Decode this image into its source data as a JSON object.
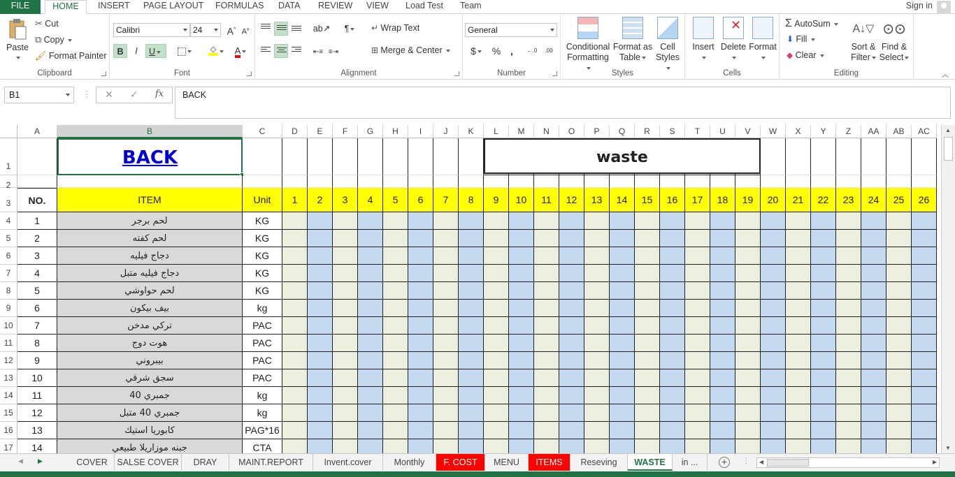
{
  "ribbon_tabs": [
    "FILE",
    "HOME",
    "INSERT",
    "PAGE LAYOUT",
    "FORMULAS",
    "DATA",
    "REVIEW",
    "VIEW",
    "Load Test",
    "Team"
  ],
  "sign_in": "Sign in",
  "clipboard": {
    "paste": "Paste",
    "cut": "Cut",
    "copy": "Copy",
    "format_painter": "Format Painter",
    "label": "Clipboard"
  },
  "font": {
    "name": "Calibri",
    "size": "24",
    "bold": "B",
    "italic": "I",
    "underline": "U",
    "color_glyph": "A",
    "label": "Font"
  },
  "alignment": {
    "wrap_text": "Wrap Text",
    "merge_center": "Merge & Center",
    "label": "Alignment"
  },
  "number": {
    "format": "General",
    "currency": "$",
    "percent": "%",
    "comma": ",",
    "inc": "←.0",
    "dec": ".00",
    "label": "Number"
  },
  "styles": {
    "conditional": "Conditional",
    "conditional2": "Formatting",
    "format_as": "Format as",
    "format_as2": "Table",
    "cell": "Cell",
    "cell2": "Styles",
    "label": "Styles"
  },
  "cells": {
    "insert": "Insert",
    "delete": "Delete",
    "format": "Format",
    "label": "Cells"
  },
  "editing": {
    "autosum": "AutoSum",
    "fill": "Fill",
    "clear": "Clear",
    "sort": "Sort &",
    "sort2": "Filter",
    "find": "Find &",
    "find2": "Select",
    "label": "Editing"
  },
  "formula_bar": {
    "name_box": "B1",
    "content": "BACK",
    "fx": "fx"
  },
  "columns": [
    "A",
    "B",
    "C",
    "D",
    "E",
    "F",
    "G",
    "H",
    "I",
    "J",
    "K",
    "L",
    "M",
    "N",
    "O",
    "P",
    "Q",
    "R",
    "S",
    "T",
    "U",
    "V",
    "W",
    "X",
    "Y",
    "Z",
    "AA",
    "AB",
    "AC"
  ],
  "rows": [
    "1",
    "2",
    "3",
    "4",
    "5",
    "6",
    "7",
    "8",
    "9",
    "10",
    "11",
    "12",
    "13",
    "14",
    "15",
    "16",
    "17"
  ],
  "sheet": {
    "back_link": "BACK",
    "title": "waste",
    "header": {
      "no": "NO.",
      "item": "ITEM",
      "unit": "Unit"
    },
    "days": [
      "1",
      "2",
      "3",
      "4",
      "5",
      "6",
      "7",
      "8",
      "9",
      "10",
      "11",
      "12",
      "13",
      "14",
      "15",
      "16",
      "17",
      "18",
      "19",
      "20",
      "21",
      "22",
      "23",
      "24",
      "25",
      "26"
    ],
    "items": [
      {
        "no": "1",
        "item": "لحم برجر",
        "unit": "KG"
      },
      {
        "no": "2",
        "item": "لحم كفته",
        "unit": "KG"
      },
      {
        "no": "3",
        "item": "دجاج فيليه",
        "unit": "KG"
      },
      {
        "no": "4",
        "item": "دجاج فيليه متبل",
        "unit": "KG"
      },
      {
        "no": "5",
        "item": "لحم حواوشي",
        "unit": "KG"
      },
      {
        "no": "6",
        "item": "بيف بيكون",
        "unit": "kg"
      },
      {
        "no": "7",
        "item": "تركي مدخن",
        "unit": "PAC"
      },
      {
        "no": "8",
        "item": "هوت دوج",
        "unit": "PAC"
      },
      {
        "no": "9",
        "item": "بيبروني",
        "unit": "PAC"
      },
      {
        "no": "10",
        "item": "سجق شرقي",
        "unit": "PAC"
      },
      {
        "no": "11",
        "item": "جمبري 40",
        "unit": "kg"
      },
      {
        "no": "12",
        "item": "جمبري 40 متبل",
        "unit": "kg"
      },
      {
        "no": "13",
        "item": "كابوريا استيك",
        "unit": "PAG*16"
      },
      {
        "no": "14",
        "item": "جبنه موزاريلا طبيعي",
        "unit": "CTA"
      }
    ]
  },
  "sheet_tabs": [
    "COVER",
    "SALSE COVER",
    "DRAY",
    "MAINT.REPORT",
    "Invent.cover",
    "Monthly",
    "F. COST",
    "MENU",
    "ITEMS",
    "Reseving",
    "WASTE",
    "in ..."
  ],
  "colors": {
    "accent": "#217346",
    "header_fill": "#ffff00",
    "item_fill": "#d9d9d9",
    "green_fill": "#ebf1de",
    "blue_fill": "#c5d9f1",
    "red_tab": "#ff0000"
  }
}
